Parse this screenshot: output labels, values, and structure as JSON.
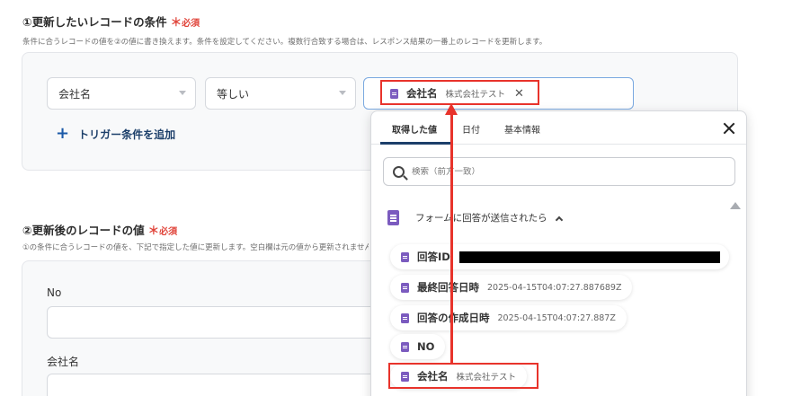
{
  "section1": {
    "title": "①更新したいレコードの条件",
    "required_mark": "＊",
    "required_text": "必須",
    "description": "条件に合うレコードの値を②の値に書き換えます。条件を設定してください。複数行合致する場合は、レスポンス結果の一番上のレコードを更新します。"
  },
  "condition": {
    "field": "会社名",
    "operator": "等しい",
    "value_chip": {
      "label": "会社名",
      "value": "株式会社テスト"
    },
    "add_trigger": "トリガー条件を追加"
  },
  "section2": {
    "title": "②更新後のレコードの値",
    "required_mark": "＊",
    "required_text": "必須",
    "description": "①の条件に合うレコードの値を、下記で指定した値に更新します。空白欄は元の値から更新されません。"
  },
  "fields": [
    {
      "label": "No"
    },
    {
      "label": "会社名"
    }
  ],
  "dropdown": {
    "tabs": [
      "取得した値",
      "日付",
      "基本情報"
    ],
    "active_tab": "取得した値",
    "search_placeholder": "検索（前方一致）",
    "group_title": "フォームに回答が送信されたら",
    "items": [
      {
        "label": "回答ID",
        "value": ""
      },
      {
        "label": "最終回答日時",
        "value": "2025-04-15T04:07:27.887689Z"
      },
      {
        "label": "回答の作成日時",
        "value": "2025-04-15T04:07:27.887Z"
      },
      {
        "label": "NO",
        "value": ""
      },
      {
        "label": "会社名",
        "value": "株式会社テスト"
      }
    ]
  },
  "icons": {
    "form_icon": "google-forms-icon",
    "accent_color": "#7b5bbf",
    "highlight_color": "#e8332b"
  }
}
